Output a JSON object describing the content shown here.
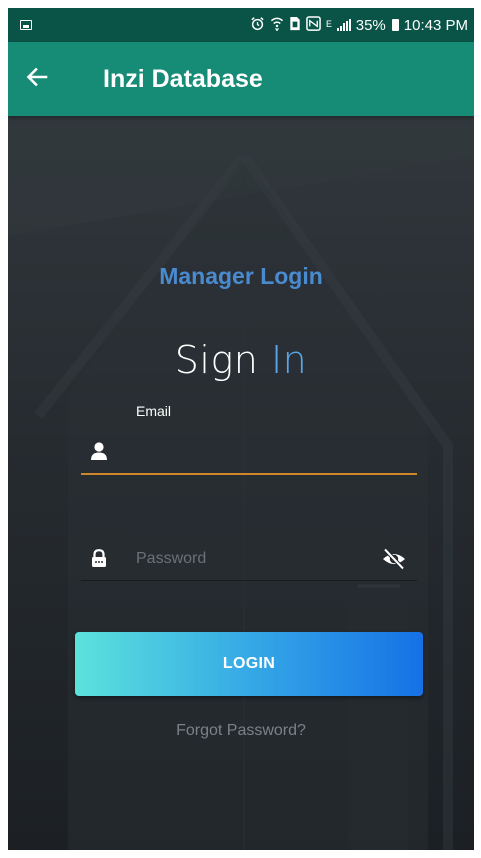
{
  "status_bar": {
    "signal_marker": "ᴱ",
    "battery_percent": "35%",
    "time": "10:43 PM"
  },
  "app_bar": {
    "title": "Inzi Database"
  },
  "login": {
    "heading": "Manager Login",
    "sign_in_part1": "Sign",
    "sign_in_part2": "In",
    "email_label": "Email",
    "email_value": "",
    "password_placeholder": "Password",
    "login_button": "LOGIN",
    "forgot_password": "Forgot Password?"
  },
  "colors": {
    "status_bar": "#0a5447",
    "app_bar": "#168b76",
    "heading": "#4a8bd0",
    "sign_in_accent": "#5aa6e6",
    "email_underline": "#d0862c",
    "button_gradient_start": "#5ce2dc",
    "button_gradient_end": "#1671e6"
  },
  "icons": {
    "status_left": "gallery-icon",
    "status_right": [
      "alarm-icon",
      "wifi-icon",
      "sim-icon",
      "nfc-icon",
      "signal-icon",
      "battery-icon"
    ],
    "back": "arrow-left-icon",
    "email_field": "person-icon",
    "password_field": "lock-icon",
    "password_toggle": "eye-off-icon"
  }
}
